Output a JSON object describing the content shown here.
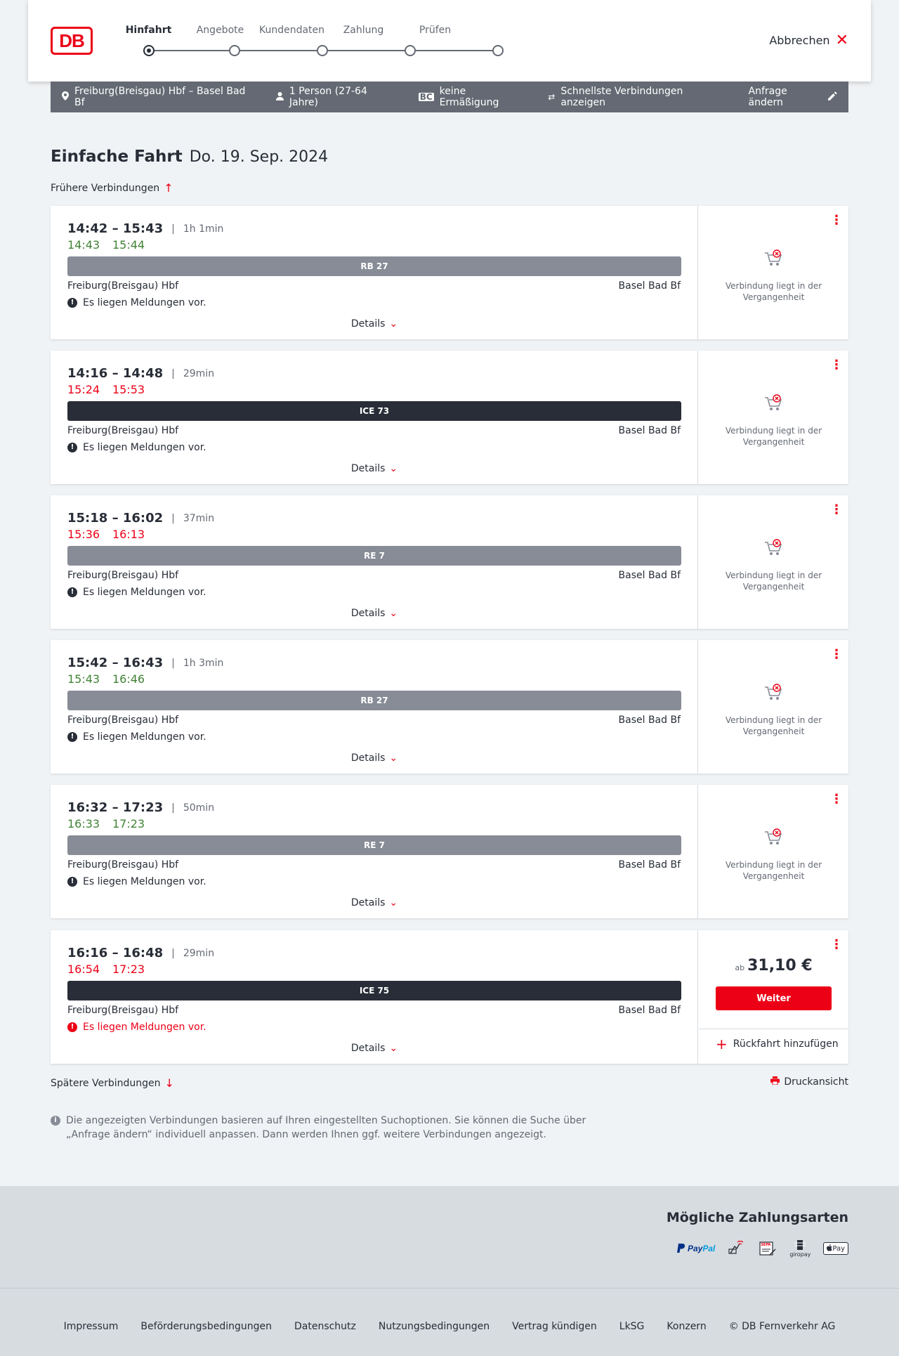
{
  "header": {
    "logo_text": "DB",
    "steps": [
      {
        "label": "Hinfahrt",
        "active": true
      },
      {
        "label": "Angebote",
        "active": false
      },
      {
        "label": "Kundendaten",
        "active": false
      },
      {
        "label": "Zahlung",
        "active": false
      },
      {
        "label": "Prüfen",
        "active": false
      }
    ],
    "cancel_label": "Abbrechen"
  },
  "infobar": {
    "route": "Freiburg(Breisgau) Hbf – Basel Bad Bf",
    "passengers": "1 Person (27-64 Jahre)",
    "discount": "keine Ermäßigung",
    "discount_badge": "BC",
    "fastest": "Schnellste Verbindungen anzeigen",
    "edit_label": "Anfrage ändern"
  },
  "page": {
    "title_type": "Einfache Fahrt",
    "title_date": "Do. 19. Sep. 2024",
    "earlier_label": "Frühere Verbindungen",
    "later_label": "Spätere Verbindungen",
    "print_label": "Druckansicht",
    "note": "Die angezeigten Verbindungen basieren auf Ihren eingestellten Suchoptionen. Sie können die Suche über „Anfrage ändern“ individuell anpassen. Dann werden Ihnen ggf. weitere Verbindungen angezeigt."
  },
  "connections": [
    {
      "dep": "14:42",
      "arr": "15:43",
      "duration": "1h 1min",
      "rt_dep": "14:43",
      "rt_arr": "15:44",
      "rt_status": "green",
      "train": "RB 27",
      "train_kind": "regional",
      "from": "Freiburg(Breisgau) Hbf",
      "to": "Basel Bad Bf",
      "message": "Es liegen Meldungen vor.",
      "message_alert": false,
      "details_label": "Details",
      "status": "Verbindung liegt in der Vergangenheit"
    },
    {
      "dep": "14:16",
      "arr": "14:48",
      "duration": "29min",
      "rt_dep": "15:24",
      "rt_arr": "15:53",
      "rt_status": "red",
      "train": "ICE 73",
      "train_kind": "ice",
      "from": "Freiburg(Breisgau) Hbf",
      "to": "Basel Bad Bf",
      "message": "Es liegen Meldungen vor.",
      "message_alert": false,
      "details_label": "Details",
      "status": "Verbindung liegt in der Vergangenheit"
    },
    {
      "dep": "15:18",
      "arr": "16:02",
      "duration": "37min",
      "rt_dep": "15:36",
      "rt_arr": "16:13",
      "rt_status": "red",
      "train": "RE 7",
      "train_kind": "regional",
      "from": "Freiburg(Breisgau) Hbf",
      "to": "Basel Bad Bf",
      "message": "Es liegen Meldungen vor.",
      "message_alert": false,
      "details_label": "Details",
      "status": "Verbindung liegt in der Vergangenheit"
    },
    {
      "dep": "15:42",
      "arr": "16:43",
      "duration": "1h 3min",
      "rt_dep": "15:43",
      "rt_arr": "16:46",
      "rt_status": "green",
      "train": "RB 27",
      "train_kind": "regional",
      "from": "Freiburg(Breisgau) Hbf",
      "to": "Basel Bad Bf",
      "message": "Es liegen Meldungen vor.",
      "message_alert": false,
      "details_label": "Details",
      "status": "Verbindung liegt in der Vergangenheit"
    },
    {
      "dep": "16:32",
      "arr": "17:23",
      "duration": "50min",
      "rt_dep": "16:33",
      "rt_arr": "17:23",
      "rt_status": "green",
      "train": "RE 7",
      "train_kind": "regional",
      "from": "Freiburg(Breisgau) Hbf",
      "to": "Basel Bad Bf",
      "message": "Es liegen Meldungen vor.",
      "message_alert": false,
      "details_label": "Details",
      "status": "Verbindung liegt in der Vergangenheit"
    },
    {
      "dep": "16:16",
      "arr": "16:48",
      "duration": "29min",
      "rt_dep": "16:54",
      "rt_arr": "17:23",
      "rt_status": "red",
      "train": "ICE 75",
      "train_kind": "ice",
      "from": "Freiburg(Breisgau) Hbf",
      "to": "Basel Bad Bf",
      "message": "Es liegen Meldungen vor.",
      "message_alert": true,
      "details_label": "Details",
      "price_prefix": "ab",
      "price": "31,10 €",
      "button_label": "Weiter",
      "return_label": "Rückfahrt hinzufügen"
    }
  ],
  "payment": {
    "title": "Mögliche Zahlungsarten",
    "paypal_a": "Pay",
    "paypal_b": "Pal",
    "sepa_label": "SEPA",
    "giropay_label": "giropay",
    "applepay_label": "Pay"
  },
  "footer": {
    "links": [
      "Impressum",
      "Beförderungsbedingungen",
      "Datenschutz",
      "Nutzungsbedingungen",
      "Vertrag kündigen",
      "LkSG",
      "Konzern",
      "© DB Fernverkehr AG"
    ]
  },
  "colors": {
    "brand_red": "#ec0016",
    "delay_red": "#ec0016",
    "ontime_green": "#408335",
    "ice_bar": "#282d37",
    "regional_bar": "#878c96"
  }
}
